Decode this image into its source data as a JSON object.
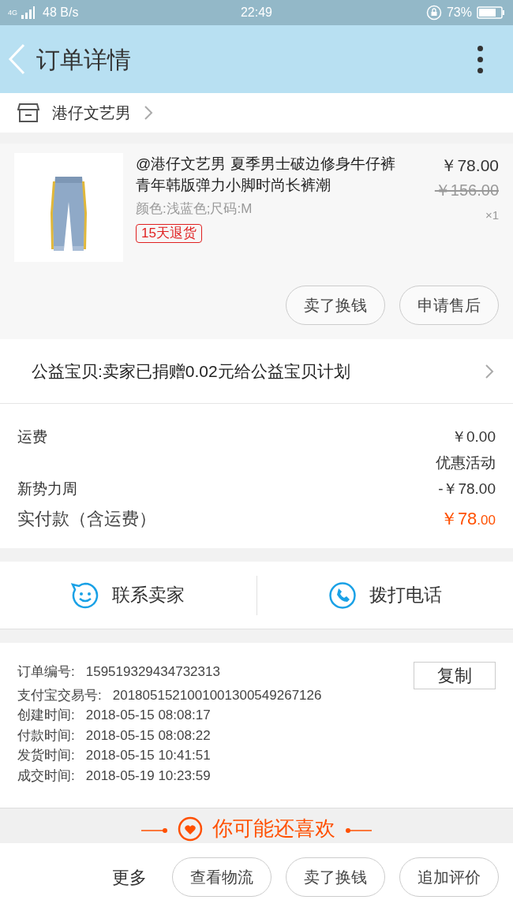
{
  "status_bar": {
    "network": "4G",
    "speed": "48 B/s",
    "time": "22:49",
    "battery": "73%"
  },
  "header": {
    "title": "订单详情"
  },
  "shop": {
    "name": "港仔文艺男"
  },
  "product": {
    "title": "@港仔文艺男 夏季男士破边修身牛仔裤青年韩版弹力小脚时尚长裤潮",
    "sku": "颜色:浅蓝色;尺码:M",
    "tag": "15天退货",
    "price": "￥78.00",
    "original_price": "￥156.00",
    "quantity": "×1",
    "buttons": [
      "卖了换钱",
      "申请售后"
    ]
  },
  "charity": {
    "text": "公益宝贝:卖家已捐赠0.02元给公益宝贝计划"
  },
  "fees": [
    {
      "label": "运费",
      "value": "￥0.00",
      "kind": "plain"
    },
    {
      "value": "优惠活动",
      "kind": "note"
    },
    {
      "label": "新势力周",
      "value": "-￥78.00",
      "kind": "plain"
    },
    {
      "label": "实付款（含运费）",
      "value": "￥78",
      "decimals": ".00",
      "kind": "total"
    }
  ],
  "contact": [
    {
      "label": "联系卖家",
      "kind": "chat"
    },
    {
      "label": "拨打电话",
      "kind": "phone"
    }
  ],
  "order_info": {
    "copy_button": "复制",
    "rows": [
      {
        "label": "订单编号:",
        "value": "159519329434732313"
      },
      {
        "label": "支付宝交易号:",
        "value": "2018051521001001300549267126"
      },
      {
        "label": "创建时间:",
        "value": "2018-05-15 08:08:17"
      },
      {
        "label": "付款时间:",
        "value": "2018-05-15 08:08:22"
      },
      {
        "label": "发货时间:",
        "value": "2018-05-15 10:41:51"
      },
      {
        "label": "成交时间:",
        "value": "2018-05-19 10:23:59"
      }
    ]
  },
  "recommend": {
    "title": "你可能还喜欢"
  },
  "bottom_bar": {
    "more": "更多",
    "buttons": [
      "查看物流",
      "卖了换钱",
      "追加评价"
    ]
  }
}
